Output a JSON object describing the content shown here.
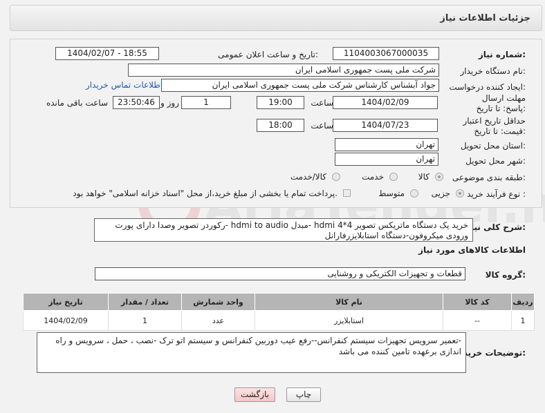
{
  "header": {
    "title": "جزئیات اطلاعات نیاز"
  },
  "labels": {
    "need_number": "شماره نیاز:",
    "announce_datetime": "تاریخ و ساعت اعلان عمومی:",
    "buyer_org": "نام دستگاه خریدار:",
    "requester": "ایجاد کننده درخواست:",
    "reply_deadline": "مهلت ارسال پاسخ: تا تاریخ:",
    "price_validity": "حداقل تاریخ اعتبار قیمت: تا تاریخ:",
    "time": "ساعت",
    "day_and": "روز و",
    "remaining": "ساعت باقی مانده",
    "province": "استان محل تحویل:",
    "city": "شهر محل تحویل:",
    "category": "طبقه بندی موضوعی:",
    "purchase_type": "نوع فرآیند خرید :",
    "general_desc": "شرح کلی نیاز:",
    "items_info": "اطلاعات کالاهای مورد نیاز",
    "goods_group": "گروه کالا:",
    "buyer_notes": "توضیحات خریدار:"
  },
  "values": {
    "need_number": "1104003067000035",
    "announce_datetime": "1404/02/07 - 18:55",
    "buyer_org": "شرکت ملی پست جمهوری اسلامی ایران",
    "requester": "جواد آبشناس کارشناس شرکت ملی پست جمهوری اسلامی ایران",
    "contact_link": "اطلاعات تماس خریدار",
    "reply_date": "1404/02/09",
    "reply_time": "19:00",
    "days": "1",
    "remaining_time": "23:50:46",
    "validity_date": "1404/07/23",
    "validity_time": "18:00",
    "province": "تهران",
    "city": "تهران"
  },
  "category_options": [
    {
      "label": "کالا",
      "selected": true
    },
    {
      "label": "خدمت",
      "selected": false
    },
    {
      "label": "کالا/خدمت",
      "selected": false
    }
  ],
  "purchase_options": [
    {
      "label": "جزیی",
      "selected": true
    },
    {
      "label": "متوسط",
      "selected": false
    }
  ],
  "payment_note": "پرداخت تمام یا بخشی از مبلغ خرید،از محل \"اسناد خزانه اسلامی\" خواهد بود.",
  "general_description": "خرید یک دستگاه ماتریکس تصویر hdmi 4*4 -مبدل hdmi to audio -رکوردر تصویر وصدا دارای پورت ورودی میکروفون-دستگاه استابلایزرفارانل",
  "goods_group": "قطعات و تجهیزات الکتریکی و روشنایی",
  "table": {
    "headers": [
      "ردیف",
      "کد کالا",
      "نام کالا",
      "واحد شمارش",
      "تعداد / مقدار",
      "تاریخ نیاز"
    ],
    "rows": [
      [
        "1",
        "--",
        "استابلایزر",
        "عدد",
        "1",
        "1404/02/09"
      ]
    ]
  },
  "buyer_notes": "-تعمیر سرویس تجهیزات سیستم کنفرانس--رفع عیب دوربین کنفرانس و سیستم اتو ترک -نصب ، حمل ، سرویس و راه اندازی برعهده تامین کننده می باشد",
  "buttons": {
    "print": "چاپ",
    "back": "بازگشت"
  },
  "watermark_text": "AriaTender.net"
}
